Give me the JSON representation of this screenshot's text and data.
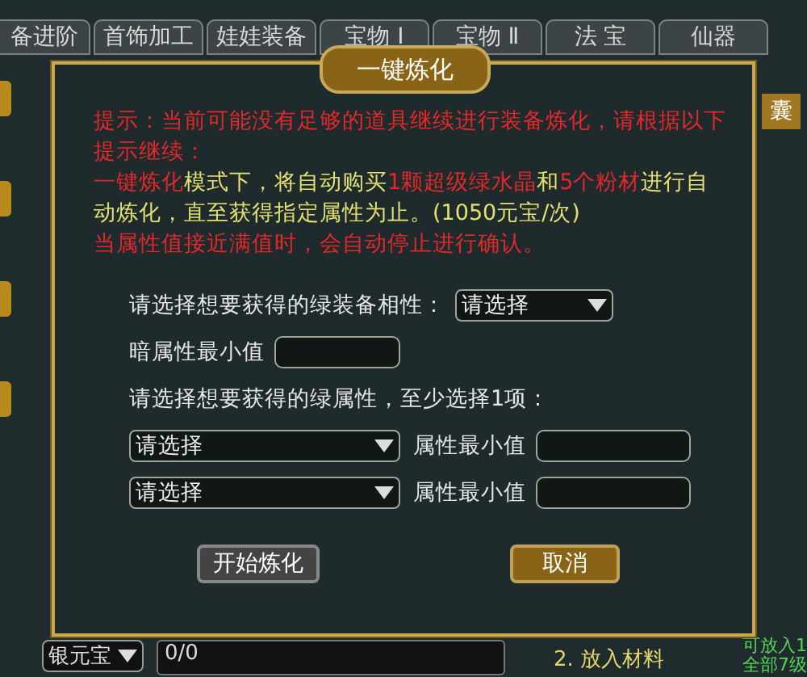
{
  "background": {
    "tabs": [
      {
        "label": "备进阶",
        "selected": false
      },
      {
        "label": "首饰加工",
        "selected": false
      },
      {
        "label": "娃娃装备",
        "selected": false
      },
      {
        "label": "宝物 Ⅰ",
        "selected": false
      },
      {
        "label": "宝物 Ⅱ",
        "selected": false
      },
      {
        "label": "法 宝",
        "selected": false
      },
      {
        "label": "仙器",
        "selected": false
      }
    ],
    "side_label": "囊",
    "currency": "银元宝",
    "amount": "0/0",
    "step": "2. 放入材料",
    "hint_lines": [
      "可放入1",
      "全部7级"
    ]
  },
  "dialog": {
    "title": "一键炼化",
    "notice": [
      [
        {
          "text": "提示：当前可能没有足够的道具继续进行装备炼化，请根据以下提示继续：",
          "kind": "alert"
        }
      ],
      [
        {
          "text": "一键炼化",
          "kind": "alert"
        },
        {
          "text": "模式下，将自动购买",
          "kind": "plain"
        },
        {
          "text": "1颗超级绿水晶",
          "kind": "alert"
        },
        {
          "text": "和",
          "kind": "plain"
        },
        {
          "text": "5个粉材",
          "kind": "alert"
        },
        {
          "text": "进行自动炼化，直至获得指定属性为止。(1050元宝/次)",
          "kind": "plain"
        }
      ],
      [
        {
          "text": "当属性值接近满值时，会自动停止进行确认。",
          "kind": "alert"
        }
      ]
    ],
    "affinity_label": "请选择想要获得的绿装备相性：",
    "affinity_select": "请选择",
    "dark_min_label": "暗属性最小值",
    "green_label": "请选择想要获得的绿属性，至少选择1项：",
    "attributes": [
      {
        "select": "请选择",
        "min_label": "属性最小值"
      },
      {
        "select": "请选择",
        "min_label": "属性最小值"
      }
    ],
    "buttons": [
      {
        "label": "开始炼化",
        "kind": "plain"
      },
      {
        "label": "取消",
        "kind": "gold"
      }
    ]
  }
}
